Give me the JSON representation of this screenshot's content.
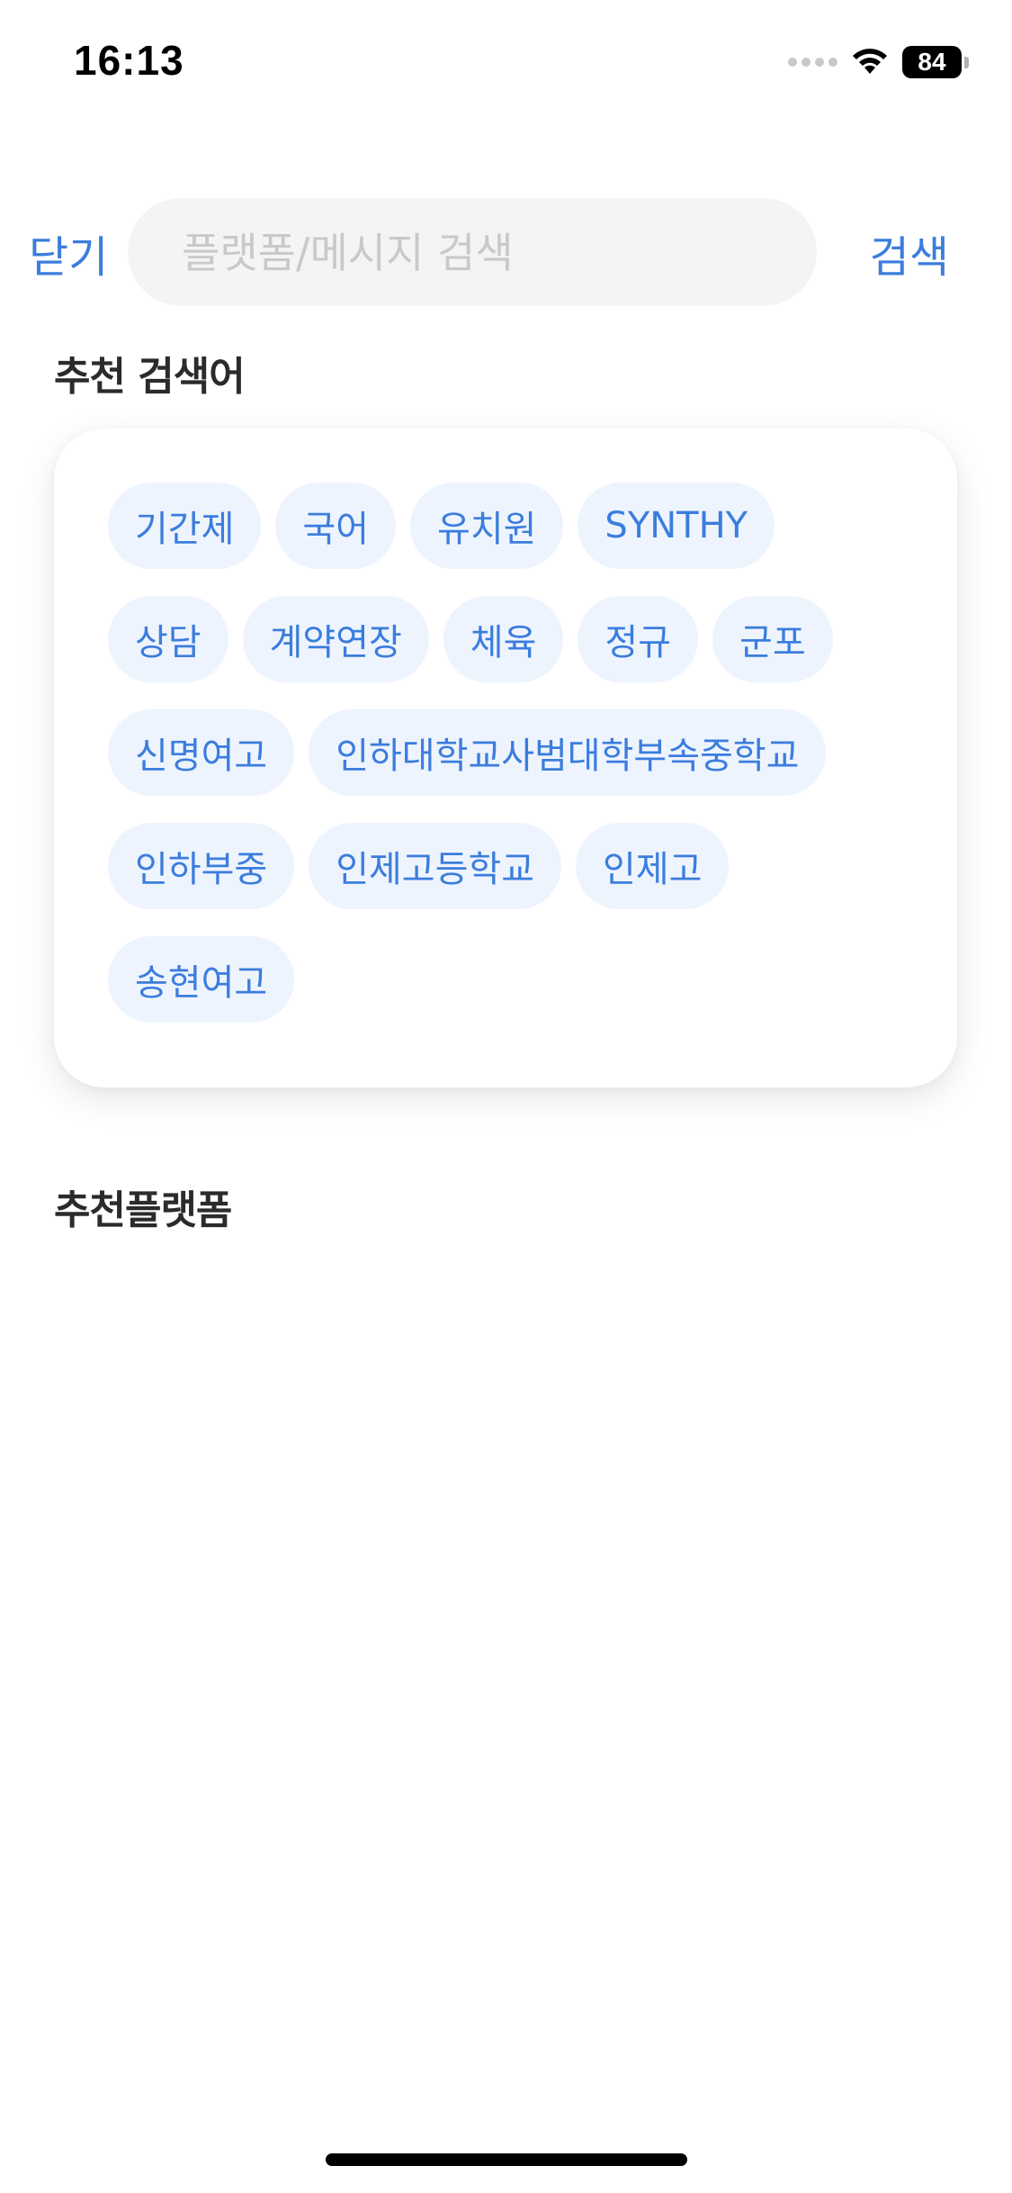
{
  "status_bar": {
    "time": "16:13",
    "battery_level": "84",
    "icons": [
      "signal-dots-icon",
      "wifi-icon",
      "battery-icon"
    ]
  },
  "search": {
    "close_label": "닫기",
    "placeholder": "플랫폼/메시지 검색",
    "value": "",
    "submit_label": "검색"
  },
  "recommended_keywords": {
    "title": "추천 검색어",
    "keywords": [
      "기간제",
      "국어",
      "유치원",
      "SYNTHY",
      "상담",
      "계약연장",
      "체육",
      "정규",
      "군포",
      "신명여고",
      "인하대학교사범대학부속중학교",
      "인하부중",
      "인제고등학교",
      "인제고",
      "송현여고"
    ]
  },
  "recommended_platforms": {
    "title": "추천플랫폼"
  },
  "colors": {
    "accent": "#3b7ddd",
    "chip_background": "#eef4fe",
    "input_background": "#f4f4f5"
  }
}
